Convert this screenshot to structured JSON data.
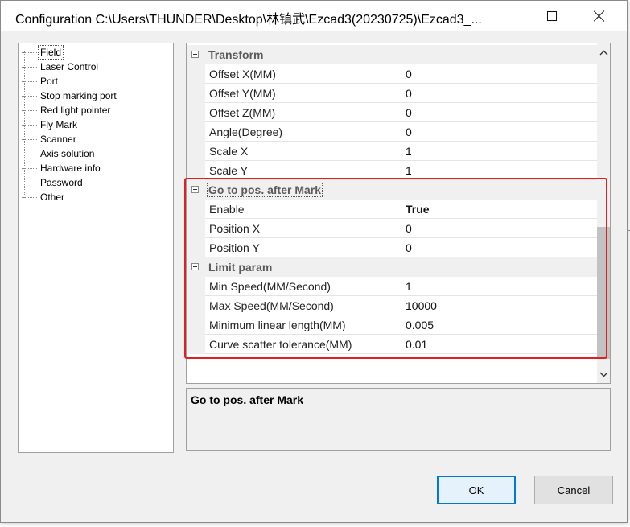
{
  "window": {
    "title": "Configuration C:\\Users\\THUNDER\\Desktop\\林镇武\\Ezcad3(20230725)\\Ezcad3_..."
  },
  "tree": {
    "items": [
      {
        "label": "Field",
        "selected": true
      },
      {
        "label": "Laser Control"
      },
      {
        "label": "Port"
      },
      {
        "label": "Stop marking port"
      },
      {
        "label": "Red light pointer"
      },
      {
        "label": "Fly Mark"
      },
      {
        "label": "Scanner"
      },
      {
        "label": "Axis solution"
      },
      {
        "label": "Hardware info"
      },
      {
        "label": "Password"
      },
      {
        "label": "Other"
      }
    ]
  },
  "grid": {
    "categories": [
      {
        "label": "Transform",
        "properties": [
          {
            "name": "Offset X(MM)",
            "value": "0"
          },
          {
            "name": "Offset Y(MM)",
            "value": "0"
          },
          {
            "name": "Offset Z(MM)",
            "value": "0"
          },
          {
            "name": "Angle(Degree)",
            "value": "0"
          },
          {
            "name": "Scale X",
            "value": "1"
          },
          {
            "name": "Scale Y",
            "value": "1"
          }
        ]
      },
      {
        "label": "Go to pos. after Mark",
        "properties": [
          {
            "name": "Enable",
            "value": "True"
          },
          {
            "name": "Position X",
            "value": "0"
          },
          {
            "name": "Position Y",
            "value": "0"
          }
        ]
      },
      {
        "label": "Limit param",
        "properties": [
          {
            "name": "Min Speed(MM/Second)",
            "value": "1"
          },
          {
            "name": "Max Speed(MM/Second)",
            "value": "10000"
          },
          {
            "name": "Minimum linear length(MM)",
            "value": "0.005"
          },
          {
            "name": "Curve scatter tolerance(MM)",
            "value": "0.01"
          }
        ]
      }
    ]
  },
  "description": {
    "title": "Go to pos. after Mark"
  },
  "buttons": {
    "ok_label": "OK",
    "cancel_label": "Cancel"
  },
  "colors": {
    "highlight_box": "#e02020",
    "default_button_border": "#0078d7"
  }
}
